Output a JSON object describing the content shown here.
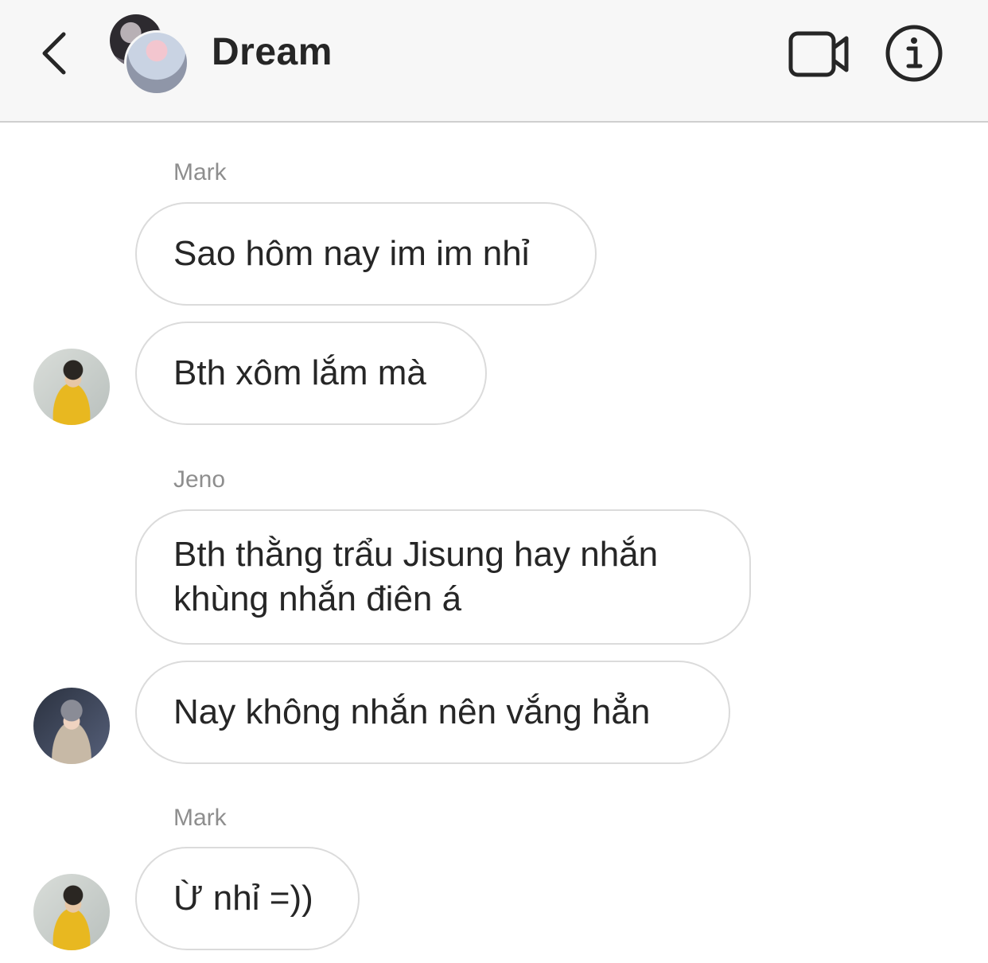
{
  "header": {
    "title": "Dream",
    "icons": {
      "back": "chevron-left-icon",
      "video": "video-camera-icon",
      "info": "info-icon"
    }
  },
  "messages": [
    {
      "sender": "Mark",
      "bubbles": [
        "Sao hôm nay im im nhỉ",
        "Bth xôm lắm mà"
      ],
      "avatar": "avatar-yellow-hoodie"
    },
    {
      "sender": "Jeno",
      "bubbles": [
        "Bth thằng trẩu Jisung hay nhắn khùng nhắn điên á",
        "Nay không nhắn nên vắng hẳn"
      ],
      "avatar": "avatar-mirror-selfie"
    },
    {
      "sender": "Mark",
      "bubbles": [
        "Ừ nhỉ =))"
      ],
      "avatar": "avatar-yellow-hoodie"
    }
  ]
}
